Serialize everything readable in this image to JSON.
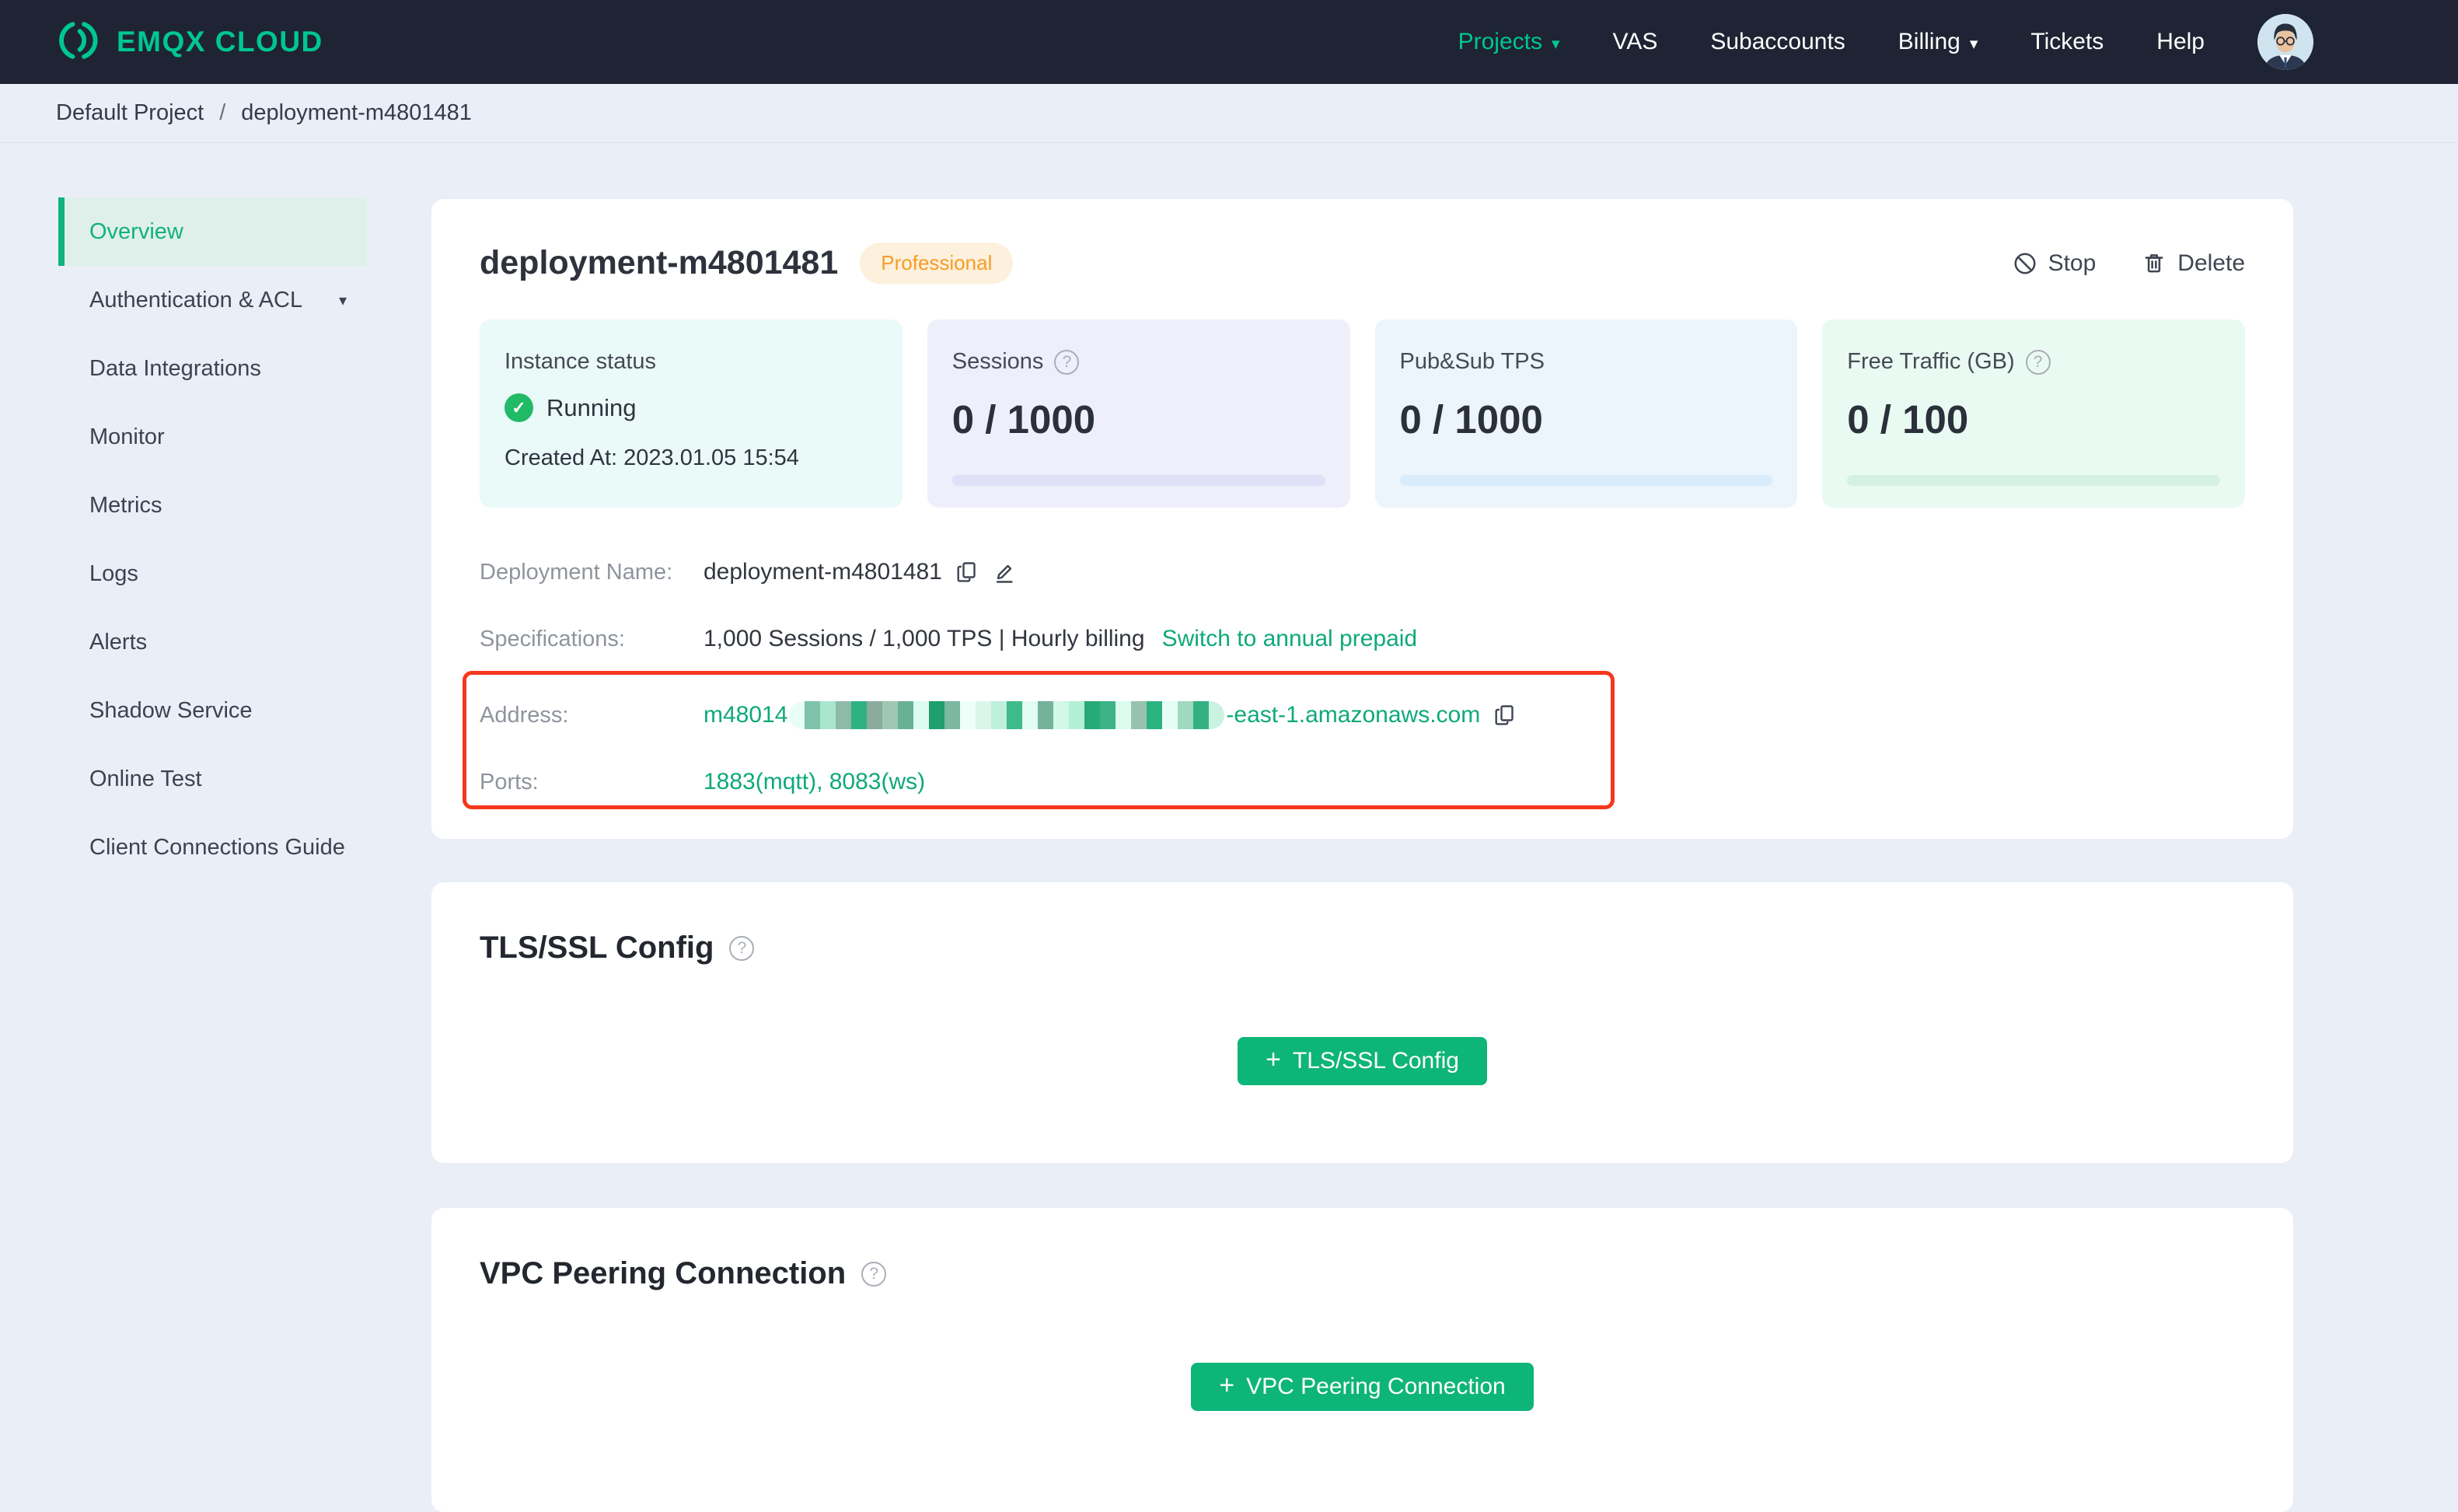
{
  "icons": {
    "help": "?",
    "caret_down": "▾",
    "plus": "+",
    "check": "✓",
    "breadcrumb_sep": "/"
  },
  "colors": {
    "topbar_bg": "#1e2433",
    "page_bg": "#eaeef7",
    "logo_green": "#00c692",
    "accent_green": "#0eb578",
    "link_green": "#0fa97a",
    "active_sidebar_green": "#12b17e",
    "status_green": "#21ba66",
    "badge_bg": "#fdf0dc",
    "badge_text": "#f59d28",
    "annotation_red": "#f5371c",
    "instance_card_bg": "#eafaf9",
    "sessions_card_bg": "#eeeffb",
    "tps_card_bg": "#ecf4fc",
    "traffic_card_bg": "#e9faf2"
  },
  "brand": {
    "name": "EMQX CLOUD"
  },
  "topnav": {
    "items": [
      {
        "label": "Projects"
      },
      {
        "label": "VAS"
      },
      {
        "label": "Subaccounts"
      },
      {
        "label": "Billing"
      },
      {
        "label": "Tickets"
      },
      {
        "label": "Help"
      }
    ]
  },
  "breadcrumb": {
    "project": "Default Project",
    "current": "deployment-m4801481"
  },
  "sidebar": {
    "items": [
      {
        "label": "Overview"
      },
      {
        "label": "Authentication & ACL"
      },
      {
        "label": "Data Integrations"
      },
      {
        "label": "Monitor"
      },
      {
        "label": "Metrics"
      },
      {
        "label": "Logs"
      },
      {
        "label": "Alerts"
      },
      {
        "label": "Shadow Service"
      },
      {
        "label": "Online Test"
      },
      {
        "label": "Client Connections Guide"
      }
    ]
  },
  "overview": {
    "title": "deployment-m4801481",
    "badge": "Professional",
    "stop_label": "Stop",
    "delete_label": "Delete",
    "metrics": {
      "instance": {
        "label": "Instance status",
        "status": "Running",
        "created": "Created At: 2023.01.05 15:54"
      },
      "sessions": {
        "label": "Sessions",
        "value": "0 / 1000"
      },
      "tps": {
        "label": "Pub&Sub TPS",
        "value": "0 / 1000"
      },
      "traffic": {
        "label": "Free Traffic (GB)",
        "value": "0 / 100"
      }
    },
    "details": {
      "name_label": "Deployment Name:",
      "name_value": "deployment-m4801481",
      "spec_label": "Specifications:",
      "spec_value": "1,000 Sessions / 1,000 TPS | Hourly billing",
      "spec_link": "Switch to annual prepaid",
      "address_label": "Address:",
      "address_prefix": "m48014",
      "address_suffix": "-east-1.amazonaws.com",
      "address_redacted_blocks": [
        "#e8fdf6",
        "#7fc3ab",
        "#a9e6cf",
        "#8fb9a9",
        "#2db381",
        "#8aab9d",
        "#9fc7b4",
        "#68b194",
        "#dcfbf2",
        "#1f9e6e",
        "#7cb8a0",
        "#eefffa",
        "#d9f6e8",
        "#bff0db",
        "#3eba8b",
        "#e2fcf4",
        "#74b29a",
        "#d2f8e7",
        "#b2f0d6",
        "#27aa78",
        "#3cb487",
        "#dcfbee",
        "#97c2b0",
        "#2ab37f",
        "#e6fdf6",
        "#9fd9c0",
        "#34b183",
        "#c9f3e0"
      ],
      "ports_label": "Ports:",
      "ports_value": "1883(mqtt), 8083(ws)"
    }
  },
  "tls": {
    "title": "TLS/SSL Config",
    "button_label": "TLS/SSL Config"
  },
  "vpc": {
    "title": "VPC Peering Connection",
    "button_label": "VPC Peering Connection"
  }
}
